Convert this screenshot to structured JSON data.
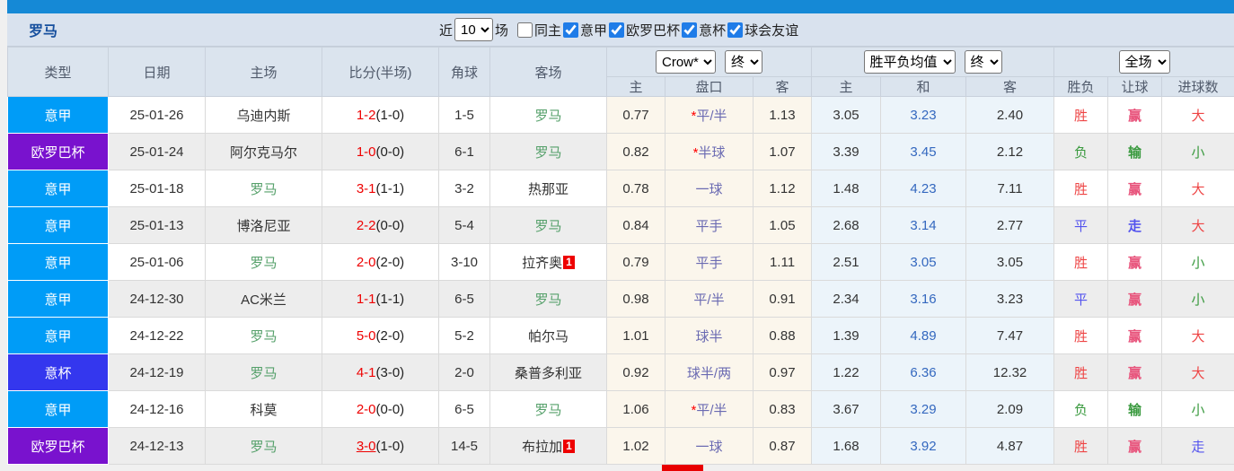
{
  "title": "罗马",
  "controls": {
    "recent_label": "近",
    "recent_value": "10",
    "matches_label": "场",
    "same_home_label": "同主",
    "same_home_checked": false,
    "leagues": [
      {
        "label": "意甲",
        "checked": true
      },
      {
        "label": "欧罗巴杯",
        "checked": true
      },
      {
        "label": "意杯",
        "checked": true
      },
      {
        "label": "球会友谊",
        "checked": true
      }
    ]
  },
  "header": {
    "static_cols": [
      "类型",
      "日期",
      "主场",
      "比分(半场)",
      "角球",
      "客场"
    ],
    "groups": {
      "odds_source": "Crow*",
      "odds_period": "终",
      "avg_source": "胜平负均值",
      "avg_period": "终",
      "result_scope": "全场"
    },
    "odds_sub": [
      "主",
      "盘口",
      "客"
    ],
    "avg_sub": [
      "主",
      "和",
      "客"
    ],
    "result_sub": [
      "胜负",
      "让球",
      "进球数"
    ]
  },
  "league_colors": {
    "seriea": "#009cf7",
    "europa": "#7912ce",
    "coppa": "#3437ee"
  },
  "rows": [
    {
      "league": "意甲",
      "league_key": "seriea",
      "date": "25-01-26",
      "home": "乌迪内斯",
      "home_roma": false,
      "score": "1-2",
      "half": "(1-0)",
      "score_underline": false,
      "corners": "1-5",
      "away": "罗马",
      "away_roma": true,
      "away_badge": "",
      "crow_home": "0.77",
      "handicap_prefix": "*",
      "handicap": "平/半",
      "crow_away": "1.13",
      "avg_home": "3.05",
      "avg_draw": "3.23",
      "avg_away": "2.40",
      "wdl": "胜",
      "wdl_color": "red",
      "rang": "赢",
      "rang_color": "red",
      "goals": "大",
      "goals_color": "red"
    },
    {
      "league": "欧罗巴杯",
      "league_key": "europa",
      "date": "25-01-24",
      "home": "阿尔克马尔",
      "home_roma": false,
      "score": "1-0",
      "half": "(0-0)",
      "score_underline": false,
      "corners": "6-1",
      "away": "罗马",
      "away_roma": true,
      "away_badge": "",
      "crow_home": "0.82",
      "handicap_prefix": "*",
      "handicap": "半球",
      "crow_away": "1.07",
      "avg_home": "3.39",
      "avg_draw": "3.45",
      "avg_away": "2.12",
      "wdl": "负",
      "wdl_color": "green",
      "rang": "输",
      "rang_color": "green",
      "goals": "小",
      "goals_color": "green"
    },
    {
      "league": "意甲",
      "league_key": "seriea",
      "date": "25-01-18",
      "home": "罗马",
      "home_roma": true,
      "score": "3-1",
      "half": "(1-1)",
      "score_underline": false,
      "corners": "3-2",
      "away": "热那亚",
      "away_roma": false,
      "away_badge": "",
      "crow_home": "0.78",
      "handicap_prefix": "",
      "handicap": "一球",
      "crow_away": "1.12",
      "avg_home": "1.48",
      "avg_draw": "4.23",
      "avg_away": "7.11",
      "wdl": "胜",
      "wdl_color": "red",
      "rang": "赢",
      "rang_color": "red",
      "goals": "大",
      "goals_color": "red"
    },
    {
      "league": "意甲",
      "league_key": "seriea",
      "date": "25-01-13",
      "home": "博洛尼亚",
      "home_roma": false,
      "score": "2-2",
      "half": "(0-0)",
      "score_underline": false,
      "corners": "5-4",
      "away": "罗马",
      "away_roma": true,
      "away_badge": "",
      "crow_home": "0.84",
      "handicap_prefix": "",
      "handicap": "平手",
      "crow_away": "1.05",
      "avg_home": "2.68",
      "avg_draw": "3.14",
      "avg_away": "2.77",
      "wdl": "平",
      "wdl_color": "blue",
      "rang": "走",
      "rang_color": "blue",
      "goals": "大",
      "goals_color": "red"
    },
    {
      "league": "意甲",
      "league_key": "seriea",
      "date": "25-01-06",
      "home": "罗马",
      "home_roma": true,
      "score": "2-0",
      "half": "(2-0)",
      "score_underline": false,
      "corners": "3-10",
      "away": "拉齐奥",
      "away_roma": false,
      "away_badge": "1",
      "crow_home": "0.79",
      "handicap_prefix": "",
      "handicap": "平手",
      "crow_away": "1.11",
      "avg_home": "2.51",
      "avg_draw": "3.05",
      "avg_away": "3.05",
      "wdl": "胜",
      "wdl_color": "red",
      "rang": "赢",
      "rang_color": "red",
      "goals": "小",
      "goals_color": "green"
    },
    {
      "league": "意甲",
      "league_key": "seriea",
      "date": "24-12-30",
      "home": "AC米兰",
      "home_roma": false,
      "score": "1-1",
      "half": "(1-1)",
      "score_underline": false,
      "corners": "6-5",
      "away": "罗马",
      "away_roma": true,
      "away_badge": "",
      "crow_home": "0.98",
      "handicap_prefix": "",
      "handicap": "平/半",
      "crow_away": "0.91",
      "avg_home": "2.34",
      "avg_draw": "3.16",
      "avg_away": "3.23",
      "wdl": "平",
      "wdl_color": "blue",
      "rang": "赢",
      "rang_color": "red",
      "goals": "小",
      "goals_color": "green"
    },
    {
      "league": "意甲",
      "league_key": "seriea",
      "date": "24-12-22",
      "home": "罗马",
      "home_roma": true,
      "score": "5-0",
      "half": "(2-0)",
      "score_underline": false,
      "corners": "5-2",
      "away": "帕尔马",
      "away_roma": false,
      "away_badge": "",
      "crow_home": "1.01",
      "handicap_prefix": "",
      "handicap": "球半",
      "crow_away": "0.88",
      "avg_home": "1.39",
      "avg_draw": "4.89",
      "avg_away": "7.47",
      "wdl": "胜",
      "wdl_color": "red",
      "rang": "赢",
      "rang_color": "red",
      "goals": "大",
      "goals_color": "red"
    },
    {
      "league": "意杯",
      "league_key": "coppa",
      "date": "24-12-19",
      "home": "罗马",
      "home_roma": true,
      "score": "4-1",
      "half": "(3-0)",
      "score_underline": false,
      "corners": "2-0",
      "away": "桑普多利亚",
      "away_roma": false,
      "away_badge": "",
      "crow_home": "0.92",
      "handicap_prefix": "",
      "handicap": "球半/两",
      "crow_away": "0.97",
      "avg_home": "1.22",
      "avg_draw": "6.36",
      "avg_away": "12.32",
      "wdl": "胜",
      "wdl_color": "red",
      "rang": "赢",
      "rang_color": "red",
      "goals": "大",
      "goals_color": "red"
    },
    {
      "league": "意甲",
      "league_key": "seriea",
      "date": "24-12-16",
      "home": "科莫",
      "home_roma": false,
      "score": "2-0",
      "half": "(0-0)",
      "score_underline": false,
      "corners": "6-5",
      "away": "罗马",
      "away_roma": true,
      "away_badge": "",
      "crow_home": "1.06",
      "handicap_prefix": "*",
      "handicap": "平/半",
      "crow_away": "0.83",
      "avg_home": "3.67",
      "avg_draw": "3.29",
      "avg_away": "2.09",
      "wdl": "负",
      "wdl_color": "green",
      "rang": "输",
      "rang_color": "green",
      "goals": "小",
      "goals_color": "green"
    },
    {
      "league": "欧罗巴杯",
      "league_key": "europa",
      "date": "24-12-13",
      "home": "罗马",
      "home_roma": true,
      "score": "3-0",
      "half": "(1-0)",
      "score_underline": true,
      "corners": "14-5",
      "away": "布拉加",
      "away_roma": false,
      "away_badge": "1",
      "crow_home": "1.02",
      "handicap_prefix": "",
      "handicap": "一球",
      "crow_away": "0.87",
      "avg_home": "1.68",
      "avg_draw": "3.92",
      "avg_away": "4.87",
      "wdl": "胜",
      "wdl_color": "red",
      "rang": "赢",
      "rang_color": "red",
      "goals": "走",
      "goals_color": "blue"
    }
  ]
}
